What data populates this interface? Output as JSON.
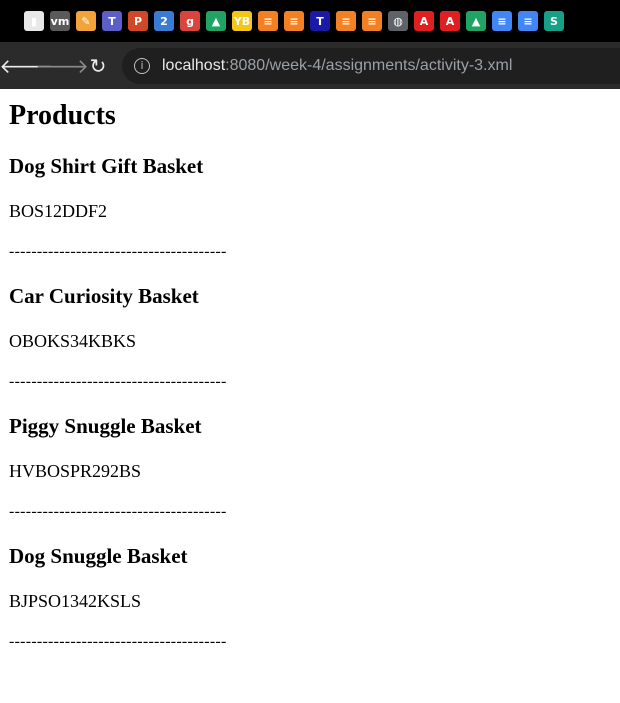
{
  "browser": {
    "bookmarks": [
      {
        "icon": "notion-icon",
        "glyph": "▮",
        "color": "#e8e8e8"
      },
      {
        "icon": "vmware-icon",
        "glyph": "vm",
        "color": "#5a5a5a"
      },
      {
        "icon": "pencil-icon",
        "glyph": "✎",
        "color": "#f2a33a"
      },
      {
        "icon": "teams-icon",
        "glyph": "T",
        "color": "#5b5fc7"
      },
      {
        "icon": "powerpoint-icon",
        "glyph": "P",
        "color": "#d24726"
      },
      {
        "icon": "scheduler-icon",
        "glyph": "2",
        "color": "#3a7bd5"
      },
      {
        "icon": "grammarly-icon",
        "glyph": "g",
        "color": "#d9453c"
      },
      {
        "icon": "google-drive-icon",
        "glyph": "▲",
        "color": "#1fa463"
      },
      {
        "icon": "yb-icon",
        "glyph": "YB",
        "color": "#f5c518"
      },
      {
        "icon": "stackoverflow-icon",
        "glyph": "≡",
        "color": "#f48024"
      },
      {
        "icon": "stackoverflow-icon",
        "glyph": "≡",
        "color": "#f48024"
      },
      {
        "icon": "t-icon",
        "glyph": "T",
        "color": "#1a1aa6"
      },
      {
        "icon": "stackoverflow-icon",
        "glyph": "≡",
        "color": "#f48024"
      },
      {
        "icon": "stackoverflow-icon",
        "glyph": "≡",
        "color": "#f48024"
      },
      {
        "icon": "globe-icon",
        "glyph": "◍",
        "color": "#5f6368"
      },
      {
        "icon": "adobe-icon",
        "glyph": "A",
        "color": "#e02020"
      },
      {
        "icon": "adobe-icon",
        "glyph": "A",
        "color": "#e02020"
      },
      {
        "icon": "google-drive-icon",
        "glyph": "▲",
        "color": "#1fa463"
      },
      {
        "icon": "google-docs-icon",
        "glyph": "≡",
        "color": "#4285f4"
      },
      {
        "icon": "google-docs-icon",
        "glyph": "≡",
        "color": "#4285f4"
      },
      {
        "icon": "s-icon",
        "glyph": "S",
        "color": "#16a085"
      }
    ],
    "url_host": "localhost",
    "url_rest": ":8080/week-4/assignments/activity-3.xml"
  },
  "page": {
    "title": "Products",
    "products": [
      {
        "name": "Dog Shirt Gift Basket",
        "sku": "BOS12DDF2",
        "separator": "---------------------------------------"
      },
      {
        "name": "Car Curiosity Basket",
        "sku": "OBOKS34KBKS",
        "separator": "---------------------------------------"
      },
      {
        "name": "Piggy Snuggle Basket",
        "sku": "HVBOSPR292BS",
        "separator": "---------------------------------------"
      },
      {
        "name": "Dog Snuggle Basket",
        "sku": "BJPSO1342KSLS",
        "separator": "---------------------------------------"
      }
    ]
  }
}
